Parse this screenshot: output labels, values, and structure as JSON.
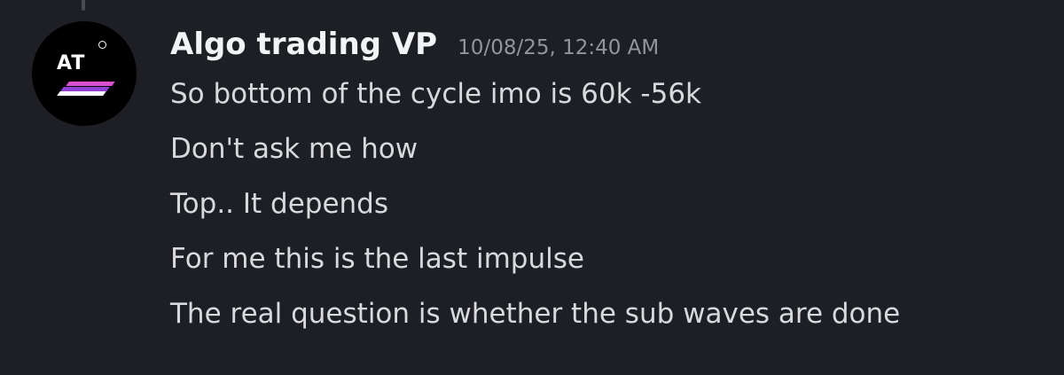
{
  "message": {
    "author": "Algo trading VP",
    "timestamp": "10/08/25, 12:40 AM",
    "avatar_text": "AT",
    "lines": [
      "So bottom of the cycle imo is 60k -56k",
      "Don't ask me how",
      "Top.. It depends",
      "For me this is the last impulse",
      "The real question is whether the sub waves are done"
    ]
  },
  "colors": {
    "background": "#1e1f24",
    "author": "#f2f3f5",
    "timestamp": "#93949c",
    "message_text": "#d8d9dd",
    "avatar_bg": "#000000",
    "avatar_stripes": [
      "#d94fd0",
      "#8f3fd6",
      "#ffffff"
    ]
  }
}
